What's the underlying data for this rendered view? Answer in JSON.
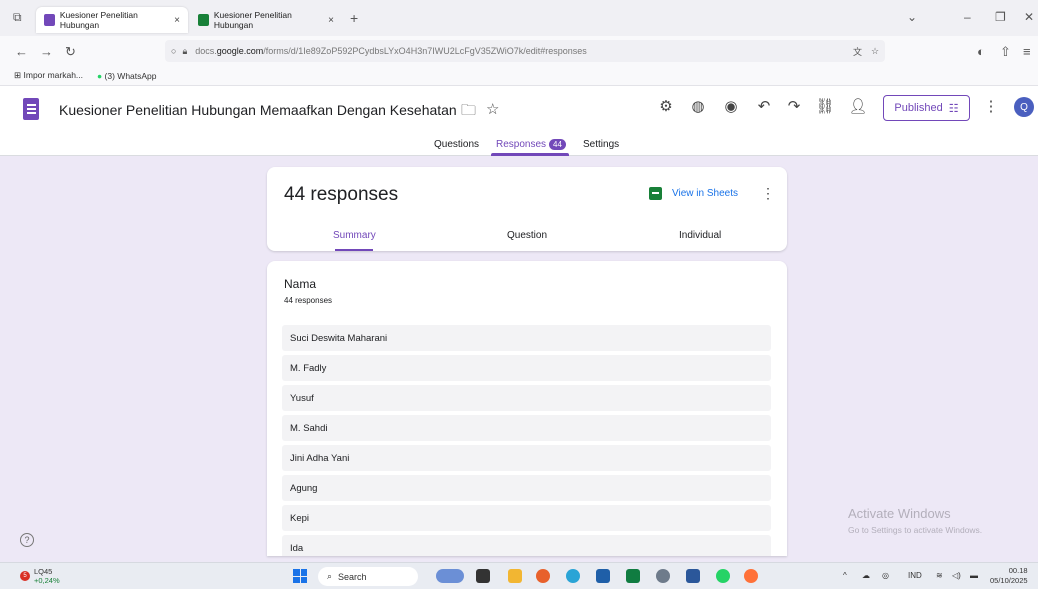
{
  "browser": {
    "tabs": [
      {
        "title": "Kuesioner Penelitian Hubungan",
        "close": "×",
        "favicon": "forms-icon",
        "color": "#7248b9"
      },
      {
        "title": "Kuesioner Penelitian Hubungan",
        "close": "×",
        "favicon": "sheets-icon",
        "color": "#188038"
      }
    ],
    "new_tab": "+",
    "url_prefix": "docs.",
    "url_domain": "google.com",
    "url_path": "/forms/d/1Ie89ZoP592PCydbsLYxO4H3n7IWU2LcFgV35ZWiO7k/edit#responses",
    "bookmarks": [
      {
        "label": "Impor markah...",
        "icon": "import-icon"
      },
      {
        "label": "(3) WhatsApp",
        "icon": "whatsapp-icon"
      }
    ]
  },
  "form": {
    "title": "Kuesioner Penelitian Hubungan Memaafkan Dengan Kesehatan Mental Ma",
    "published_label": "Published",
    "avatar_letter": "Q",
    "tabs": {
      "questions": "Questions",
      "responses": "Responses",
      "responses_count": "44",
      "settings": "Settings"
    }
  },
  "summary": {
    "heading": "44 responses",
    "view_in_sheets": "View in Sheets",
    "subtabs": {
      "summary": "Summary",
      "question": "Question",
      "individual": "Individual"
    }
  },
  "question": {
    "title": "Nama",
    "count": "44 responses",
    "answers": [
      "Suci Deswita Maharani",
      "M. Fadly",
      "Yusuf",
      "M. Sahdi",
      "Jini Adha Yani",
      "Agung",
      "Kepi",
      "Ida"
    ]
  },
  "watermark": {
    "line1": "Activate Windows",
    "line2": "Go to Settings to activate Windows."
  },
  "taskbar": {
    "stock_name": "LQ45",
    "stock_change": "+0,24%",
    "stock_badge": "5",
    "search": "Search",
    "lang": "IND",
    "time": "00.18",
    "date": "05/10/2025"
  },
  "colors": {
    "accent": "#7248b9",
    "background": "#ede8f6",
    "link": "#1a73e8"
  }
}
